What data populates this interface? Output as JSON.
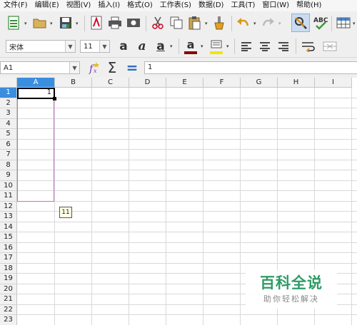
{
  "menu": [
    "文件(F)",
    "编辑(E)",
    "视图(V)",
    "插入(I)",
    "格式(O)",
    "工作表(S)",
    "数据(D)",
    "工具(T)",
    "窗口(W)",
    "帮助(H)"
  ],
  "toolbar": {
    "font_name": "宋体",
    "font_size": "11",
    "bold_glyph": "a",
    "italic_glyph": "a",
    "underline_glyph": "a",
    "font_color_glyph": "a"
  },
  "formula_bar": {
    "name_box": "A1",
    "sum_symbol": "Σ",
    "equals_symbol": "=",
    "content": "1"
  },
  "sheet": {
    "columns": [
      "A",
      "B",
      "C",
      "D",
      "E",
      "F",
      "G",
      "H",
      "I"
    ],
    "rows": [
      "1",
      "2",
      "3",
      "4",
      "5",
      "6",
      "7",
      "8",
      "9",
      "10",
      "11",
      "12",
      "13",
      "14",
      "15",
      "16",
      "17",
      "18",
      "19",
      "20",
      "21",
      "22",
      "23"
    ],
    "selected_cell": "A1",
    "a1_value": "1",
    "autofill_tooltip": "11"
  },
  "colors": {
    "selection_header": "#3a8ee0",
    "range_border": "#d066d0",
    "font_color_underline": "#8b0000",
    "highlight_underline": "#f2e600",
    "watermark_green": "#2f9b67"
  },
  "watermark": {
    "title": "百科全说",
    "subtitle": "助你轻松解决"
  }
}
